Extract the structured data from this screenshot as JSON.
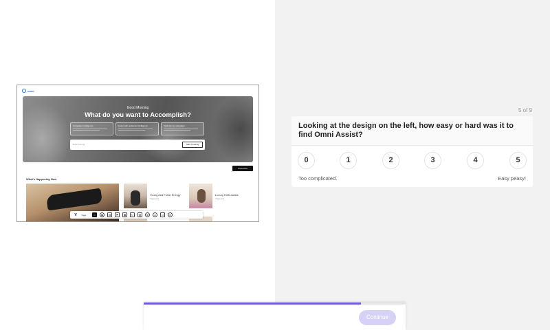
{
  "preview": {
    "brand": "omni",
    "greeting": "Good Morning",
    "headline": "What do you want to Accomplish?",
    "cards": [
      {
        "title": "Campaign Intelligence"
      },
      {
        "title": "Listen with audience intelligence"
      },
      {
        "title": "Optimize my campaign"
      }
    ],
    "prompt_placeholder": "Enter prompt",
    "start_button": "Start Creating",
    "customize_button": "Customize",
    "section_title": "What's Happening Now",
    "items": [
      {
        "title": "Young And Fresh Energy",
        "source": "Yoga.com"
      },
      {
        "title": "Luxury Enthusiasts",
        "source": "Yoga.com"
      }
    ],
    "toolbar": {
      "logo": "V",
      "label": "Yoga"
    }
  },
  "survey": {
    "step": "5 of 9",
    "question": "Looking at the design on the left, how easy or hard was it to find Omni Assist?",
    "options": [
      "0",
      "1",
      "2",
      "3",
      "4",
      "5"
    ],
    "low_label": "Too complicated.",
    "high_label": "Easy peasy!"
  },
  "footer": {
    "progress": 0.83,
    "continue_label": "Continue",
    "accent": "#6f5fd6"
  }
}
